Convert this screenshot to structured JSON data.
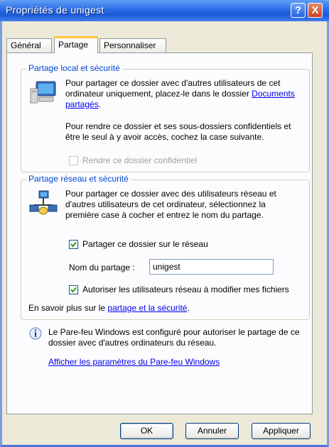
{
  "window": {
    "title": "Propriétés de unigest",
    "help_label": "?",
    "close_label": "X"
  },
  "tabs": [
    {
      "label": "Général",
      "active": false
    },
    {
      "label": "Partage",
      "active": true
    },
    {
      "label": "Personnaliser",
      "active": false
    }
  ],
  "local_group": {
    "title": "Partage local et sécurité",
    "text1": "Pour partager ce dossier avec d'autres utilisateurs de cet ordinateur uniquement, placez-le dans le dossier",
    "link": "Documents partagés",
    "after_link": ".",
    "text2": "Pour rendre ce dossier et ses sous-dossiers confidentiels et être le seul à y avoir accès, cochez la case suivante.",
    "private_checkbox": {
      "label": "Rendre ce dossier confidentiel",
      "checked": false,
      "disabled": true
    }
  },
  "network_group": {
    "title": "Partage réseau et sécurité",
    "text": "Pour partager ce dossier avec des utilisateurs réseau et d'autres utilisateurs de cet ordinateur, sélectionnez la première case à cocher et entrez le nom du partage.",
    "share_checkbox": {
      "label": "Partager ce dossier sur le réseau",
      "checked": true
    },
    "share_name_label": "Nom du partage :",
    "share_name_value": "unigest",
    "allow_checkbox": {
      "label": "Autoriser les utilisateurs réseau à modifier mes fichiers",
      "checked": true
    },
    "learn_more_prefix": "En savoir plus sur le ",
    "learn_more_link": "partage et la sécurité",
    "learn_more_suffix": "."
  },
  "firewall": {
    "text": "Le Pare-feu Windows est configuré pour autoriser le partage de ce dossier avec d'autres ordinateurs du réseau.",
    "link": "Afficher les paramètres du Pare-feu Windows"
  },
  "buttons": {
    "ok": "OK",
    "cancel": "Annuler",
    "apply": "Appliquer"
  },
  "icons": [
    "computer-icon",
    "network-share-icon",
    "info-icon",
    "help-icon",
    "close-icon"
  ]
}
